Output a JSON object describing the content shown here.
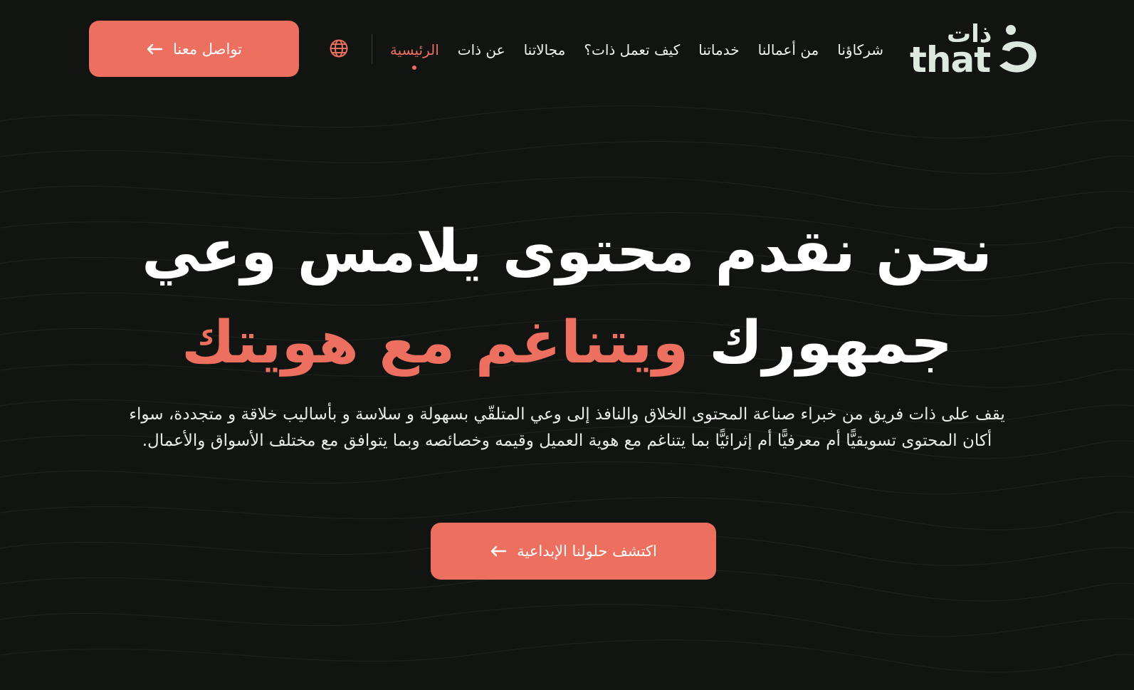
{
  "logo": {
    "arabic": "ذات",
    "latin": "that"
  },
  "nav": {
    "items": [
      {
        "label": "الرئيسية",
        "active": true
      },
      {
        "label": "عن ذات",
        "active": false
      },
      {
        "label": "مجالاتنا",
        "active": false
      },
      {
        "label": "كيف تعمل ذات؟",
        "active": false
      },
      {
        "label": "خدماتنا",
        "active": false
      },
      {
        "label": "من أعمالنا",
        "active": false
      },
      {
        "label": "شركاؤنا",
        "active": false
      }
    ]
  },
  "header": {
    "contact_label": "تواصل معنا",
    "language_icon": "globe-icon"
  },
  "hero": {
    "title_line1": "نحن نقدم محتوى يلامس وعي",
    "title_line2_plain": "جمهورك",
    "title_line2_accent": "ويتناغم مع هويتك",
    "description": "يقف على ذات فريق من خبراء صناعة المحتوى الخلاق والنافذ إلى وعي المتلقّي بسهولة و سلاسة و بأساليب خلاقة و متجددة، سواء أكان المحتوى تسويقيًّا أم معرفيًّا أم إثرائيًّا بما يتناغم مع هوية العميل وقيمه وخصائصه وبما يتوافق مع مختلف الأسواق والأعمال.",
    "cta_label": "اكتشف حلولنا الإبداعية"
  },
  "colors": {
    "background": "#111411",
    "accent": "#ec6f5f",
    "text": "#ffffff",
    "logo": "#dde8df"
  }
}
